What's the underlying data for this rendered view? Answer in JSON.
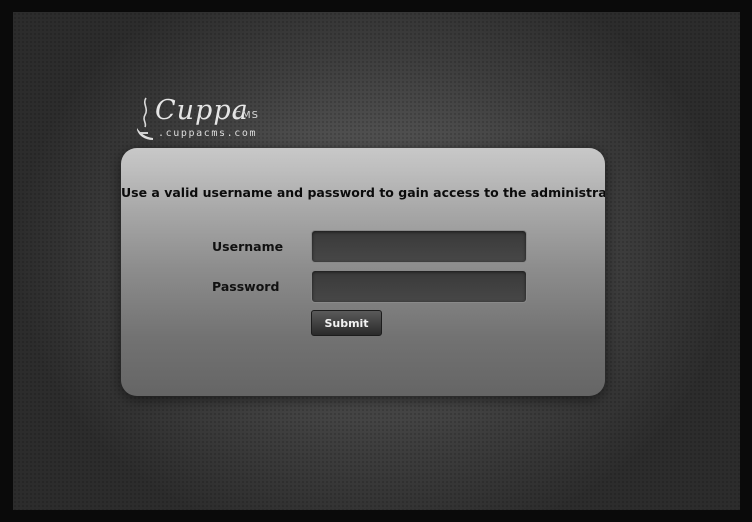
{
  "brand": {
    "name": "Cuppa",
    "suffix": "CMS",
    "url": ".cuppacms.com"
  },
  "login": {
    "message": "Use a valid username and password to gain access to the administrator",
    "username_label": "Username",
    "username_value": "",
    "password_label": "Password",
    "password_value": "",
    "submit_label": "Submit"
  },
  "icons": {
    "logo": "steaming-cup-icon"
  },
  "colors": {
    "background": "#3e3e3e",
    "panel_top": "#c8c8c8",
    "panel_bottom": "#656565",
    "input_bg": "#3a3a3a",
    "button_bg": "#3a3a3a",
    "text": "#0c0c0c"
  }
}
